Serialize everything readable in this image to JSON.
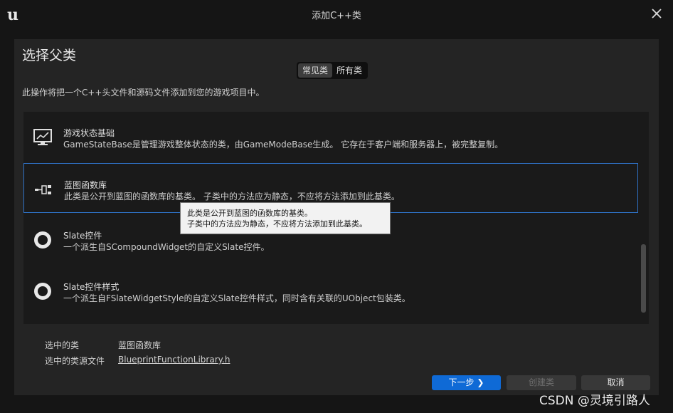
{
  "window": {
    "title": "添加C++类"
  },
  "header": {
    "title": "选择父类"
  },
  "tabs": [
    {
      "label": "常见类",
      "active": true
    },
    {
      "label": "所有类",
      "active": false
    }
  ],
  "description": "此操作将把一个C++头文件和源码文件添加到您的游戏项目中。",
  "classes": [
    {
      "icon": "monitor-graph-icon",
      "title": "游戏状态基础",
      "desc": "GameStateBase是管理游戏整体状态的类，由GameModeBase生成。 它存在于客户端和服务器上，被完整复制。"
    },
    {
      "icon": "blueprint-function-icon",
      "title": "蓝图函数库",
      "desc": "此类是公开到蓝图的函数库的基类。 子类中的方法应为静态，不应将方法添加到此基类。",
      "selected": true
    },
    {
      "icon": "ring-icon",
      "title": "Slate控件",
      "desc": "一个派生自SCompoundWidget的自定义Slate控件。"
    },
    {
      "icon": "ring-icon",
      "title": "Slate控件样式",
      "desc": "一个派生自FSlateWidgetStyle的自定义Slate控件样式，同时含有关联的UObject包装类。"
    }
  ],
  "tooltip": {
    "line1": "此类是公开到蓝图的函数库的基类。",
    "line2": "子类中的方法应为静态，不应将方法添加到此基类。"
  },
  "selection": {
    "class_label": "选中的类",
    "class_value": "蓝图函数库",
    "file_label": "选中的类源文件",
    "file_value": "BlueprintFunctionLibrary.h"
  },
  "buttons": {
    "next": "下一步",
    "create": "创建类",
    "cancel": "取消"
  },
  "watermark": "CSDN @灵境引路人",
  "colors": {
    "accent": "#0f6ad6",
    "selection_border": "#2f72c8"
  }
}
